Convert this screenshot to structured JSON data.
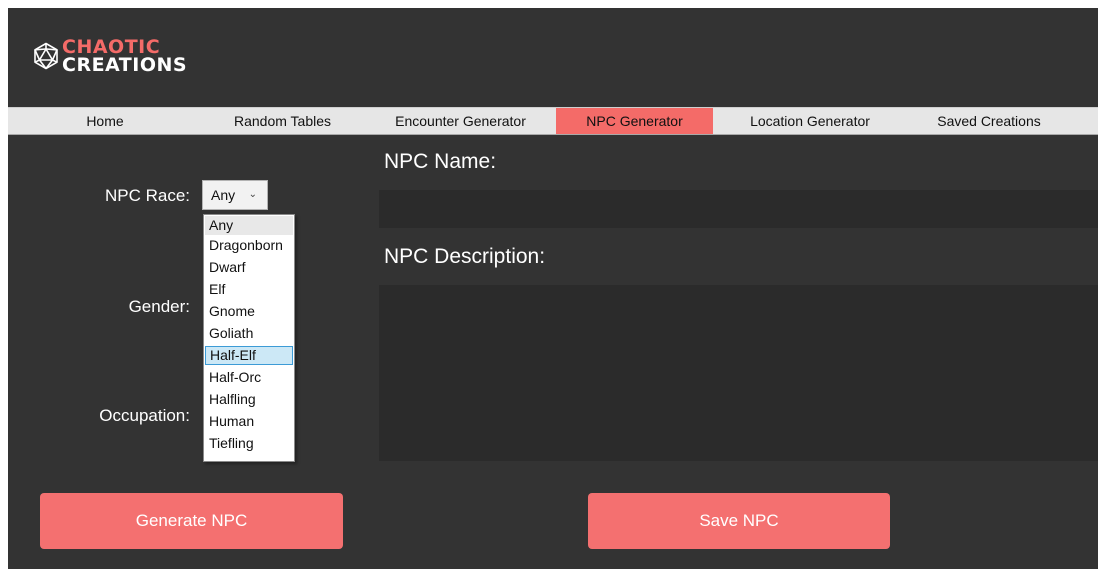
{
  "app": {
    "logo_line1": "CHAOTIC",
    "logo_line2": "CREATIONS",
    "logo_icon": "d20-icon"
  },
  "nav": {
    "items": [
      {
        "label": "Home"
      },
      {
        "label": "Random Tables"
      },
      {
        "label": "Encounter Generator"
      },
      {
        "label": "NPC Generator",
        "active": true
      },
      {
        "label": "Location Generator"
      },
      {
        "label": "Saved Creations"
      }
    ]
  },
  "form": {
    "race_label": "NPC Race:",
    "race_value": "Any",
    "gender_label": "Gender:",
    "occupation_label": "Occupation:",
    "race_options": [
      "Any",
      "Dragonborn",
      "Dwarf",
      "Elf",
      "Gnome",
      "Goliath",
      "Half-Elf",
      "Half-Orc",
      "Halfling",
      "Human",
      "Tiefling"
    ],
    "hovered_option": "Half-Elf"
  },
  "output": {
    "name_label": "NPC Name:",
    "name_value": "",
    "description_label": "NPC Description:",
    "description_value": ""
  },
  "buttons": {
    "generate_label": "Generate NPC",
    "save_label": "Save NPC"
  },
  "colors": {
    "accent": "#f46b68",
    "background": "#333333",
    "field": "#2b2b2b",
    "nav": "#e6e6e6"
  }
}
